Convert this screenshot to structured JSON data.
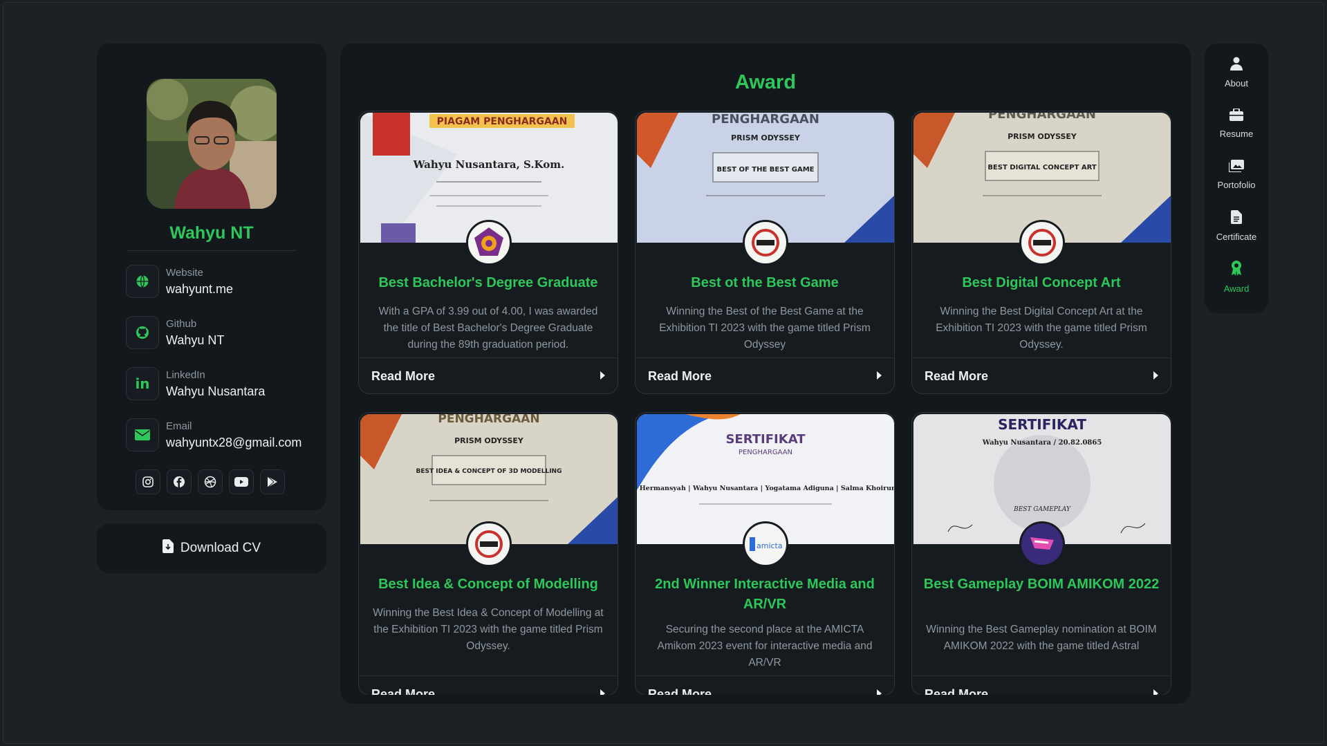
{
  "profile": {
    "name": "Wahyu NT",
    "contacts": [
      {
        "label": "Website",
        "value": "wahyunt.me",
        "icon": "globe-icon"
      },
      {
        "label": "Github",
        "value": "Wahyu NT",
        "icon": "github-icon"
      },
      {
        "label": "LinkedIn",
        "value": "Wahyu Nusantara",
        "icon": "linkedin-icon"
      },
      {
        "label": "Email",
        "value": "wahyuntx28@gmail.com",
        "icon": "email-icon"
      }
    ],
    "socials": [
      "instagram-icon",
      "facebook-icon",
      "dribbble-icon",
      "youtube-icon",
      "play-store-icon"
    ]
  },
  "download": {
    "label": "Download CV"
  },
  "section": {
    "title": "Award"
  },
  "read_more": "Read More",
  "awards": [
    {
      "title": "Best Bachelor's Degree Graduate",
      "desc": "With a GPA of 3.99 out of 4.00, I was awarded the title of Best Bachelor's Degree Graduate during the 89th graduation period.",
      "cert_head": "PIAGAM PENGHARGAAN",
      "cert_sub": "Wahyu Nusantara, S.Kom."
    },
    {
      "title": "Best ot the Best Game",
      "desc": "Winning the Best of the Best Game at the Exhibition TI 2023 with the game titled Prism Odyssey",
      "cert_head": "PENGHARGAAN",
      "cert_sub": "BEST OF THE BEST GAME"
    },
    {
      "title": "Best Digital Concept Art",
      "desc": "Winning the Best Digital Concept Art at the Exhibition TI 2023 with the game titled Prism Odyssey.",
      "cert_head": "PENGHARGAAN",
      "cert_sub": "BEST DIGITAL CONCEPT ART"
    },
    {
      "title": "Best Idea & Concept of Modelling",
      "desc": "Winning the Best Idea & Concept of Modelling at the Exhibition TI 2023 with the game titled Prism Odyssey.",
      "cert_head": "PENGHARGAAN",
      "cert_sub": "BEST IDEA & CONCEPT OF 3D MODELLING"
    },
    {
      "title": "2nd Winner Interactive Media and AR/VR",
      "desc": "Securing the second place at the AMICTA Amikom 2023 event for interactive media and AR/VR",
      "cert_head": "SERTIFIKAT",
      "cert_sub": "Vicky Hermansyah | Wahyu Nusantara | Yogatama Adiguna | Salma Khoirun nisa"
    },
    {
      "title": "Best Gameplay BOIM AMIKOM 2022",
      "desc": "Winning the Best Gameplay nomination at BOIM AMIKOM 2022 with the game titled Astral",
      "cert_head": "SERTIFIKAT",
      "cert_sub": "BEST GAMEPLAY"
    }
  ],
  "nav": [
    {
      "label": "About",
      "icon": "user-icon"
    },
    {
      "label": "Resume",
      "icon": "briefcase-icon"
    },
    {
      "label": "Portofolio",
      "icon": "images-icon"
    },
    {
      "label": "Certificate",
      "icon": "document-icon"
    },
    {
      "label": "Award",
      "icon": "award-icon"
    }
  ],
  "colors": {
    "accent": "#2ec75a",
    "panel": "#13181d",
    "background": "#1b1f23"
  }
}
